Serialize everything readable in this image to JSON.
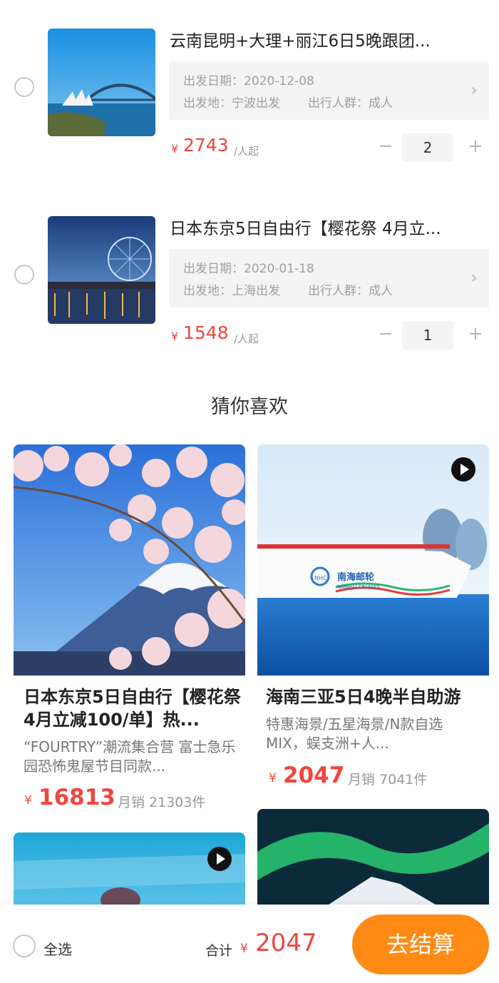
{
  "cart": {
    "items": [
      {
        "title": "云南昆明+大理+丽江6日5晚跟团...",
        "date_line": "出发日期：2020-12-08",
        "from": "出发地：宁波出发",
        "people": "出行人群：成人",
        "price_symbol": "¥",
        "price": "2743",
        "price_unit": "/人起",
        "quantity": "2",
        "minus": "−",
        "plus": "+"
      },
      {
        "title": "日本东京5日自由行【樱花祭 4月立...",
        "date_line": "出发日期：2020-01-18",
        "from": "出发地：上海出发",
        "people": "出行人群：成人",
        "price_symbol": "¥",
        "price": "1548",
        "price_unit": "/人起",
        "quantity": "1",
        "minus": "−",
        "plus": "+"
      }
    ]
  },
  "recommend": {
    "title": "猜你喜欢",
    "cards": [
      {
        "title": "日本东京5日自由行【樱花祭 4月立减100/单】热...",
        "desc": "“FOURTRY”潮流集合营 富士急乐园恐怖鬼屋节目同款...",
        "price_symbol": "¥",
        "price": "16813",
        "sales": "月销 21303件"
      },
      {
        "title": "海南三亚5日4晚半自助游",
        "desc": "特惠海景/五星海景/N款自选MIX，蜈支洲+人...",
        "price_symbol": "¥",
        "price": "2047",
        "sales": "月销 7041件",
        "ship_name_cn": "南海邮轮",
        "ship_name_en": "NANHAI CRUISES",
        "ship_logo": "NHC"
      }
    ]
  },
  "footer": {
    "select_all": "全选",
    "total_label": "合计",
    "total_symbol": "¥",
    "total": "2047",
    "checkout": "去结算"
  },
  "colors": {
    "accent_orange": "#ff8a14",
    "price_red": "#f2453d"
  },
  "icons": {
    "chevron": "chevron-right-icon",
    "play": "play-icon"
  }
}
